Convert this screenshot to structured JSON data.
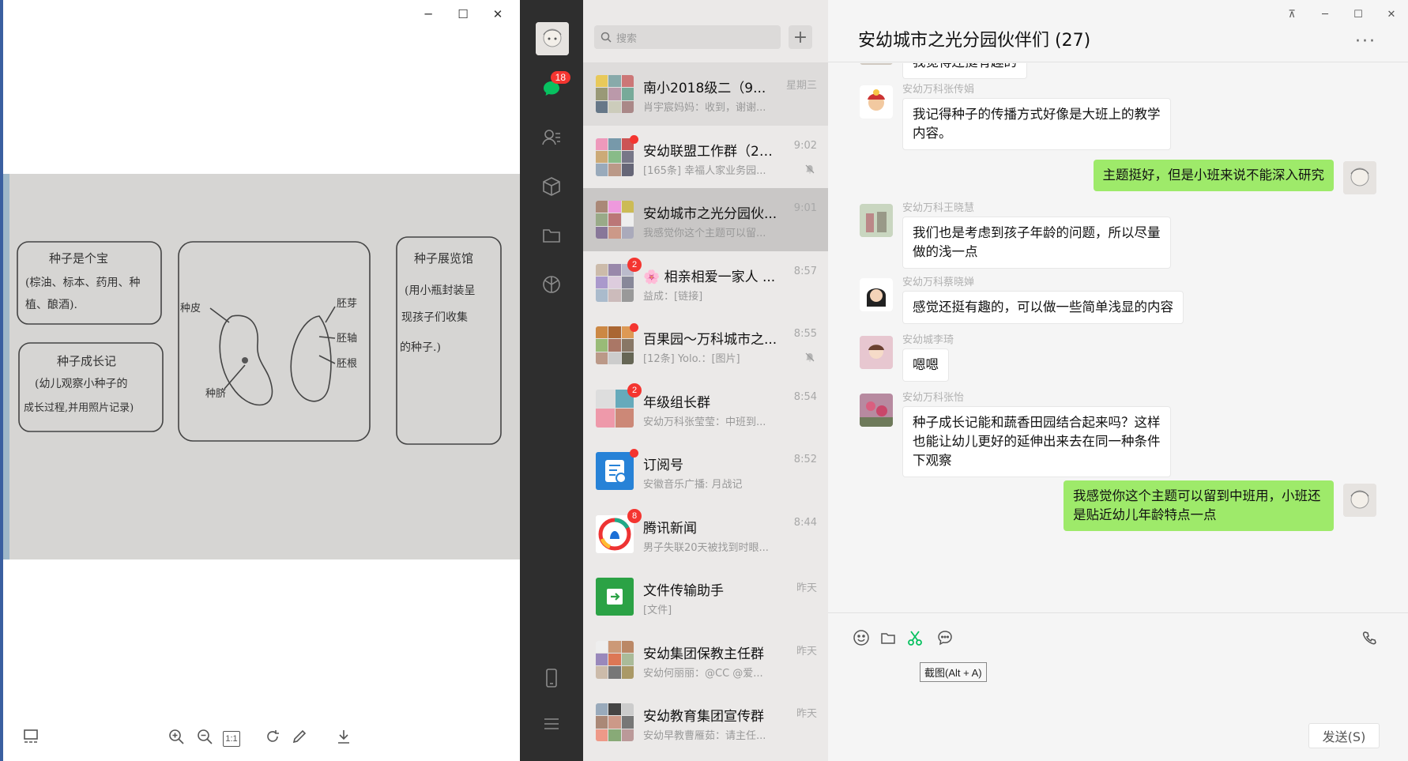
{
  "viewer": {
    "controls": {
      "minimize": "─",
      "maximize": "☐",
      "close": "✕"
    },
    "photo": {
      "box1_title": "种子是个宝",
      "box1_line1": "(棕油、标本、药用、种",
      "box1_line2": "植、酿酒).",
      "box2_title": "种子成长记",
      "box2_line1": "(幼儿观察小种子的",
      "box2_line2": "成长过程,并用照片记录)",
      "diagram_label_seedcoat": "种皮",
      "diagram_label_hilum": "种脐",
      "diagram_label_plumule": "胚芽",
      "diagram_label_hypocotyl": "胚轴",
      "diagram_label_radicle": "胚根",
      "box3_title": "种子展览馆",
      "box3_line1": "(用小瓶封装呈",
      "box3_line2": "现孩子们收集",
      "box3_line3": "的种子.)"
    },
    "toolbar": {
      "onetoone_label": "1:1"
    }
  },
  "wechat": {
    "sidebar": {
      "chat_badge": "18"
    },
    "search": {
      "placeholder": "搜索"
    },
    "plus_label": "+",
    "chats": [
      {
        "name": "南小2018级二（9...",
        "time": "星期三",
        "preview": "肖宇宸妈妈：收到，谢谢..."
      },
      {
        "name": "安幼联盟工作群（20...",
        "time": "9:02",
        "preview": "[165条] 幸福人家业务园..."
      },
      {
        "name": "安幼城市之光分园伙...",
        "time": "9:01",
        "preview": "我感觉你这个主题可以留..."
      },
      {
        "name": "🌸 相亲相爱一家人 ...",
        "time": "8:57",
        "preview": "益成：[链接]",
        "badge": "2"
      },
      {
        "name": "百果园～万科城市之...",
        "time": "8:55",
        "preview": "[12条] Yolo.：[图片]"
      },
      {
        "name": "年级组长群",
        "time": "8:54",
        "preview": "安幼万科张莹莹：中班到...",
        "badge": "2"
      },
      {
        "name": "订阅号",
        "time": "8:52",
        "preview": "安徽音乐广播: 月战记"
      },
      {
        "name": "腾讯新闻",
        "time": "8:44",
        "preview": "男子失联20天被找到时眼...",
        "badge": "8"
      },
      {
        "name": "文件传输助手",
        "time": "昨天",
        "preview": "[文件]"
      },
      {
        "name": "安幼集团保教主任群",
        "time": "昨天",
        "preview": "安幼何丽丽：@CC @爱..."
      },
      {
        "name": "安幼教育集团宣传群",
        "time": "昨天",
        "preview": "安幼早教曹雁茹：请主任..."
      }
    ],
    "chat": {
      "title": "安幼城市之光分园伙伴们 (27)",
      "more": "···",
      "controls": {
        "pin": "⊼",
        "minimize": "─",
        "maximize": "☐",
        "close": "✕"
      },
      "messages": [
        {
          "side": "left",
          "sender": "",
          "text": "我觉得还挺有趣的"
        },
        {
          "side": "left",
          "sender": "安幼万科张传娟",
          "text": "我记得种子的传播方式好像是大班上的教学内容。"
        },
        {
          "side": "right",
          "sender": "",
          "text": "主题挺好，但是小班来说不能深入研究"
        },
        {
          "side": "left",
          "sender": "安幼万科王晓慧",
          "text": "我们也是考虑到孩子年龄的问题，所以尽量做的浅一点"
        },
        {
          "side": "left",
          "sender": "安幼万科蔡晓婵",
          "text": "感觉还挺有趣的，可以做一些简单浅显的内容"
        },
        {
          "side": "left",
          "sender": "安幼城李琦",
          "text": "嗯嗯"
        },
        {
          "side": "left",
          "sender": "安幼万科张怡",
          "text": "种子成长记能和蔬香田园结合起来吗？这样也能让幼儿更好的延伸出来去在同一种条件下观察"
        },
        {
          "side": "right",
          "sender": "",
          "text": "我感觉你这个主题可以留到中班用，小班还是贴近幼儿年龄特点一点"
        }
      ],
      "tooltip": "截图(Alt + A)",
      "send_label": "发送(S)"
    }
  }
}
